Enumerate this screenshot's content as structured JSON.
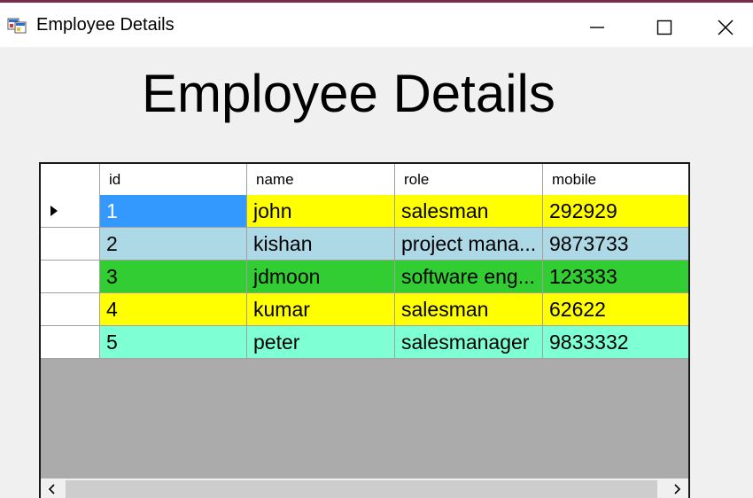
{
  "window": {
    "title": "Employee Details",
    "accent_border": "#7a2a4a"
  },
  "heading": "Employee Details",
  "grid": {
    "columns": [
      "id",
      "name",
      "role",
      "mobile"
    ],
    "current_row_index": 0,
    "rows": [
      {
        "id": "1",
        "name": "john",
        "role": "salesman",
        "mobile": "292929",
        "color": "#ffff00",
        "id_selected_color": "#3399ff"
      },
      {
        "id": "2",
        "name": "kishan",
        "role": "project mana...",
        "mobile": "9873733",
        "color": "#add8e6"
      },
      {
        "id": "3",
        "name": "jdmoon",
        "role": "software eng...",
        "mobile": "123333",
        "color": "#32cd32"
      },
      {
        "id": "4",
        "name": "kumar",
        "role": "salesman",
        "mobile": "62622",
        "color": "#ffff00"
      },
      {
        "id": "5",
        "name": "peter",
        "role": "salesmanager",
        "mobile": "9833332",
        "color": "#7fffd4"
      }
    ],
    "empty_area_color": "#ababab"
  },
  "icons": {
    "app": "app-window-icon",
    "minimize": "minimize-icon",
    "maximize": "maximize-icon",
    "close": "close-icon",
    "row_pointer": "triangle-right-icon",
    "scroll_left": "chevron-left-icon",
    "scroll_right": "chevron-right-icon"
  }
}
